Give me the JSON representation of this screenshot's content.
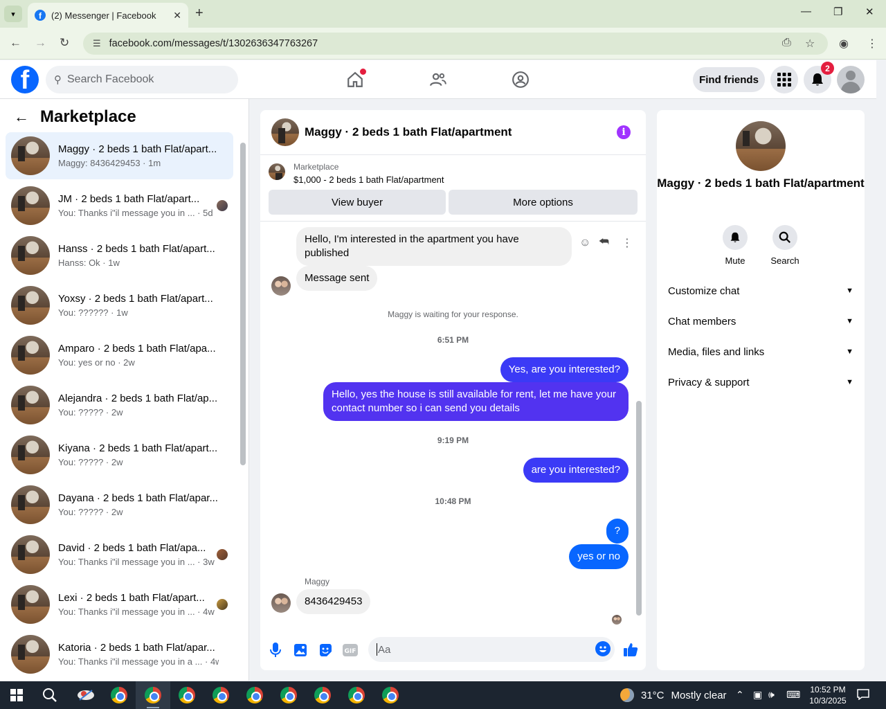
{
  "browser": {
    "tab_title": "(2) Messenger | Facebook",
    "url": "facebook.com/messages/t/1302636347763267"
  },
  "header": {
    "search_placeholder": "Search Facebook",
    "find_friends": "Find friends",
    "notifications_count": "2"
  },
  "left": {
    "title": "Marketplace",
    "conversations": [
      {
        "name": "Maggy · 2 beds 1 bath Flat/apart...",
        "preview": "Maggy: 8436429453 · 1m"
      },
      {
        "name": "JM · 2 beds 1 bath Flat/apart...",
        "preview": "You: Thanks i\"il message you in ... · 5d"
      },
      {
        "name": "Hanss · 2 beds 1 bath Flat/apart...",
        "preview": "Hanss: Ok · 1w"
      },
      {
        "name": "Yoxsy · 2 beds 1 bath Flat/apart...",
        "preview": "You: ?????? · 1w"
      },
      {
        "name": "Amparo · 2 beds 1 bath Flat/apa...",
        "preview": "You: yes or no · 2w"
      },
      {
        "name": "Alejandra · 2 beds 1 bath Flat/ap...",
        "preview": "You: ????? · 2w"
      },
      {
        "name": "Kiyana · 2 beds 1 bath Flat/apart...",
        "preview": "You: ????? · 2w"
      },
      {
        "name": "Dayana · 2 beds 1 bath Flat/apar...",
        "preview": "You: ????? · 2w"
      },
      {
        "name": "David · 2 beds 1 bath Flat/apa...",
        "preview": "You: Thanks i\"il message you in ... · 3w"
      },
      {
        "name": "Lexi · 2 beds 1 bath Flat/apart...",
        "preview": "You: Thanks i\"il message you in ... · 4w"
      },
      {
        "name": "Katoria · 2 beds 1 bath Flat/apar...",
        "preview": "You: Thanks i\"il message you in a ... · 4w"
      }
    ]
  },
  "chat": {
    "title": "Maggy · 2 beds 1 bath Flat/apartment",
    "marketplace_label": "Marketplace",
    "listing": "$1,000 - 2 beds 1 bath Flat/apartment",
    "view_buyer": "View buyer",
    "more_options": "More options",
    "msg_interested": "Hello, I'm interested in the apartment you have published",
    "msg_sent": "Message sent",
    "waiting": "Maggy is waiting for your response.",
    "time1": "6:51 PM",
    "msg_yes": "Yes, are you interested?",
    "msg_hello": "Hello, yes the house is still available for rent, let me have your contact number so i can send you details",
    "time2": "9:19 PM",
    "msg_are": "are you interested?",
    "time3": "10:48 PM",
    "msg_q": "?",
    "msg_yesno": "yes or no",
    "sender": "Maggy",
    "msg_number": "8436429453",
    "input_placeholder": "Aa"
  },
  "right": {
    "name": "Maggy · 2 beds 1 bath Flat/apartment",
    "mute": "Mute",
    "search": "Search",
    "rows": [
      "Customize chat",
      "Chat members",
      "Media, files and links",
      "Privacy & support"
    ]
  },
  "taskbar": {
    "temp": "31°C",
    "weather": "Mostly clear",
    "time": "10:52 PM",
    "date": "10/3/2025"
  }
}
